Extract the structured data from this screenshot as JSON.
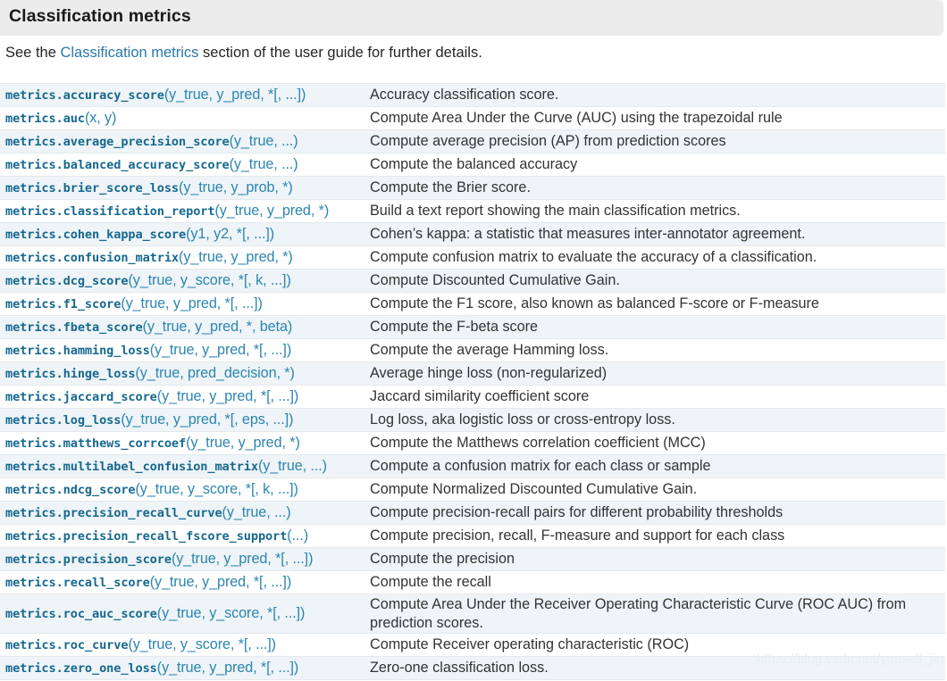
{
  "section": {
    "title": "Classification metrics"
  },
  "intro": {
    "before": "See the ",
    "link": "Classification metrics",
    "after": " section of the user guide for further details."
  },
  "colors": {
    "header_band": "#ececec",
    "row_alt": "#eef4f7",
    "row_base": "#ffffff",
    "row_border": "#e4e9ec",
    "link": "#2878a8",
    "signature_name": "#16688f",
    "signature_args": "#2c85b0",
    "text": "#252525",
    "watermark": "#e6eef3"
  },
  "watermark": "https://blog.csdn.net/youself_jin",
  "table": {
    "rows": [
      {
        "name": "metrics.accuracy_score",
        "args": "(y_true, y_pred, *[, ...])",
        "desc": "Accuracy classification score.",
        "shaded": true,
        "tall": false
      },
      {
        "name": "metrics.auc",
        "args": "(x, y)",
        "desc": "Compute Area Under the Curve (AUC) using the trapezoidal rule",
        "shaded": false,
        "tall": false
      },
      {
        "name": "metrics.average_precision_score",
        "args": "(y_true, ...)",
        "desc": "Compute average precision (AP) from prediction scores",
        "shaded": true,
        "tall": false
      },
      {
        "name": "metrics.balanced_accuracy_score",
        "args": "(y_true, ...)",
        "desc": "Compute the balanced accuracy",
        "shaded": false,
        "tall": false
      },
      {
        "name": "metrics.brier_score_loss",
        "args": "(y_true, y_prob, *)",
        "desc": "Compute the Brier score.",
        "shaded": true,
        "tall": false
      },
      {
        "name": "metrics.classification_report",
        "args": "(y_true, y_pred, *)",
        "desc": "Build a text report showing the main classification metrics.",
        "shaded": false,
        "tall": false
      },
      {
        "name": "metrics.cohen_kappa_score",
        "args": "(y1, y2, *[, ...])",
        "desc": "Cohen’s kappa: a statistic that measures inter-annotator agreement.",
        "shaded": true,
        "tall": false
      },
      {
        "name": "metrics.confusion_matrix",
        "args": "(y_true, y_pred, *)",
        "desc": "Compute confusion matrix to evaluate the accuracy of a classification.",
        "shaded": false,
        "tall": false
      },
      {
        "name": "metrics.dcg_score",
        "args": "(y_true, y_score, *[, k, ...])",
        "desc": "Compute Discounted Cumulative Gain.",
        "shaded": true,
        "tall": false
      },
      {
        "name": "metrics.f1_score",
        "args": "(y_true, y_pred, *[, ...])",
        "desc": "Compute the F1 score, also known as balanced F-score or F-measure",
        "shaded": false,
        "tall": false
      },
      {
        "name": "metrics.fbeta_score",
        "args": "(y_true, y_pred, *, beta)",
        "desc": "Compute the F-beta score",
        "shaded": true,
        "tall": false
      },
      {
        "name": "metrics.hamming_loss",
        "args": "(y_true, y_pred, *[, ...])",
        "desc": "Compute the average Hamming loss.",
        "shaded": false,
        "tall": false
      },
      {
        "name": "metrics.hinge_loss",
        "args": "(y_true, pred_decision, *)",
        "desc": "Average hinge loss (non-regularized)",
        "shaded": true,
        "tall": false
      },
      {
        "name": "metrics.jaccard_score",
        "args": "(y_true, y_pred, *[, ...])",
        "desc": "Jaccard similarity coefficient score",
        "shaded": false,
        "tall": false
      },
      {
        "name": "metrics.log_loss",
        "args": "(y_true, y_pred, *[, eps, ...])",
        "desc": "Log loss, aka logistic loss or cross-entropy loss.",
        "shaded": true,
        "tall": false
      },
      {
        "name": "metrics.matthews_corrcoef",
        "args": "(y_true, y_pred, *)",
        "desc": "Compute the Matthews correlation coefficient (MCC)",
        "shaded": false,
        "tall": false
      },
      {
        "name": "metrics.multilabel_confusion_matrix",
        "args": "(y_true, ...)",
        "desc": "Compute a confusion matrix for each class or sample",
        "shaded": true,
        "tall": false
      },
      {
        "name": "metrics.ndcg_score",
        "args": "(y_true, y_score, *[, k, ...])",
        "desc": "Compute Normalized Discounted Cumulative Gain.",
        "shaded": false,
        "tall": false
      },
      {
        "name": "metrics.precision_recall_curve",
        "args": "(y_true, ...)",
        "desc": "Compute precision-recall pairs for different probability thresholds",
        "shaded": true,
        "tall": false
      },
      {
        "name": "metrics.precision_recall_fscore_support",
        "args": "(...)",
        "desc": "Compute precision, recall, F-measure and support for each class",
        "shaded": false,
        "tall": false
      },
      {
        "name": "metrics.precision_score",
        "args": "(y_true, y_pred, *[, ...])",
        "desc": "Compute the precision",
        "shaded": true,
        "tall": false
      },
      {
        "name": "metrics.recall_score",
        "args": "(y_true, y_pred, *[, ...])",
        "desc": "Compute the recall",
        "shaded": false,
        "tall": false
      },
      {
        "name": "metrics.roc_auc_score",
        "args": "(y_true, y_score, *[, ...])",
        "desc": "Compute Area Under the Receiver Operating Characteristic Curve (ROC AUC) from prediction scores.",
        "shaded": true,
        "tall": true
      },
      {
        "name": "metrics.roc_curve",
        "args": "(y_true, y_score, *[, ...])",
        "desc": "Compute Receiver operating characteristic (ROC)",
        "shaded": false,
        "tall": false
      },
      {
        "name": "metrics.zero_one_loss",
        "args": "(y_true, y_pred, *[, ...])",
        "desc": "Zero-one classification loss.",
        "shaded": true,
        "tall": false
      }
    ]
  }
}
